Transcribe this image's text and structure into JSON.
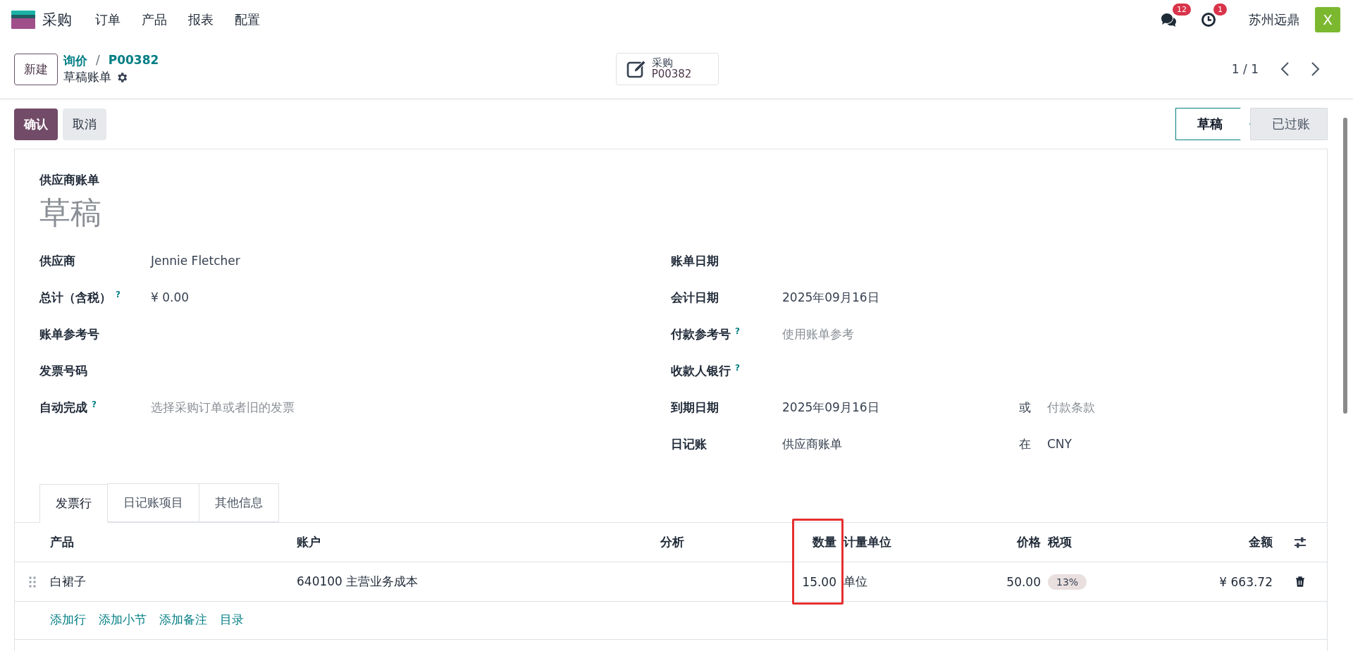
{
  "navbar": {
    "app": "采购",
    "menu": [
      "订单",
      "产品",
      "报表",
      "配置"
    ],
    "messages_count": "12",
    "activities_count": "1",
    "company": "苏州远鼎",
    "avatar": "X"
  },
  "control_panel": {
    "new_button": "新建",
    "breadcrumb": [
      "询价",
      "P00382"
    ],
    "breadcrumb_separator": "/",
    "record_title": "草稿账单",
    "smart_button": {
      "label": "采购",
      "value": "P00382"
    },
    "pager": "1 / 1"
  },
  "actions": [
    {
      "label": "确认",
      "kind": "primary"
    },
    {
      "label": "取消",
      "kind": "secondary"
    }
  ],
  "statusbar": [
    {
      "label": "草稿",
      "selected": true
    },
    {
      "label": "已过账",
      "selected": false
    }
  ],
  "form": {
    "type_label": "供应商账单",
    "name": "草稿",
    "left_fields": [
      {
        "label": "供应商",
        "value": "Jennie Fletcher"
      },
      {
        "label": "总计（含税）",
        "help": "?",
        "value": "¥ 0.00"
      },
      {
        "label": "账单参考号"
      },
      {
        "label": "发票号码"
      },
      {
        "label": "自动完成",
        "help": "?",
        "placeholder": "选择采购订单或者旧的发票"
      }
    ],
    "right_fields": [
      {
        "label": "账单日期"
      },
      {
        "label": "会计日期",
        "value": "2025年09月16日"
      },
      {
        "label": "付款参考号",
        "help": "?",
        "placeholder": "使用账单参考"
      },
      {
        "label": "收款人银行",
        "help": "?"
      },
      {
        "label": "到期日期",
        "value": "2025年09月16日",
        "extra_label": "或",
        "extra_placeholder": "付款条款"
      },
      {
        "label": "日记账",
        "value": "供应商账单",
        "extra_label": "在",
        "extra_value": "CNY"
      }
    ]
  },
  "tabs": [
    {
      "label": "发票行",
      "selected": true
    },
    {
      "label": "日记账项目",
      "selected": false
    },
    {
      "label": "其他信息",
      "selected": false
    }
  ],
  "lines": {
    "columns": [
      {
        "label": "产品",
        "highlighted": false
      },
      {
        "label": "账户",
        "highlighted": false
      },
      {
        "label": "分析",
        "highlighted": false
      },
      {
        "label": "数量",
        "highlighted": true
      },
      {
        "label": "计量单位",
        "highlighted": false
      },
      {
        "label": "价格",
        "highlighted": false
      },
      {
        "label": "税项",
        "highlighted": false
      },
      {
        "label": "金额",
        "highlighted": false
      }
    ],
    "rows": [
      {
        "cells": [
          "白裙子",
          "640100 主营业务成本",
          null,
          "15.00",
          "单位",
          "50.00",
          [
            "13%"
          ],
          "¥ 663.72"
        ]
      }
    ],
    "add_links": [
      "添加行",
      "添加小节",
      "添加备注",
      "目录"
    ]
  }
}
